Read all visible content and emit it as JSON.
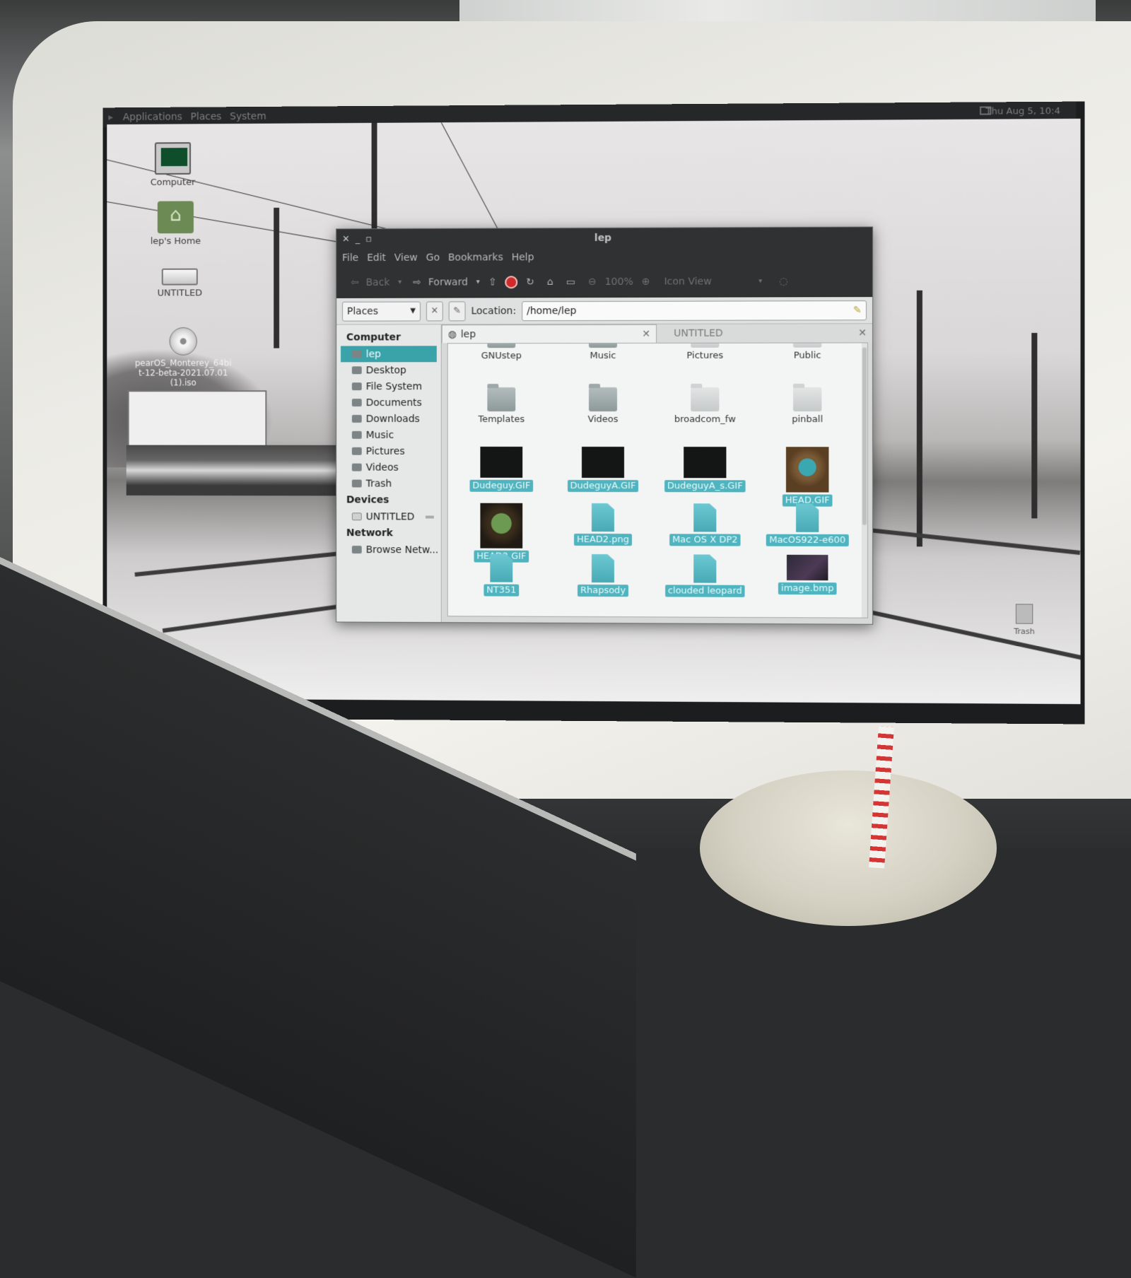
{
  "panel": {
    "menus": [
      "Applications",
      "Places",
      "System"
    ],
    "clock": "Thu Aug 5, 10:4"
  },
  "desktop_icons": [
    {
      "label": "Computer",
      "icon": "computer-icon"
    },
    {
      "label": "lep's Home",
      "icon": "home-folder-icon"
    },
    {
      "label": "UNTITLED",
      "icon": "drive-icon"
    },
    {
      "label": "pearOS_Monterey_64bit-12-beta-2021.07.01(1).iso",
      "icon": "disc-image-icon"
    },
    {
      "label": "Trash",
      "icon": "trash-icon"
    }
  ],
  "window": {
    "title": "lep",
    "menu": [
      "File",
      "Edit",
      "View",
      "Go",
      "Bookmarks",
      "Help"
    ],
    "toolbar": {
      "back": "Back",
      "forward": "Forward",
      "zoom": "100%",
      "view_mode": "Icon View"
    },
    "sidebar_select": "Places",
    "location_label": "Location:",
    "location_value": "/home/lep",
    "sidebar": {
      "computer_heading": "Computer",
      "computer_items": [
        "lep",
        "Desktop",
        "File System",
        "Documents",
        "Downloads",
        "Music",
        "Pictures",
        "Videos",
        "Trash"
      ],
      "devices_heading": "Devices",
      "devices_items": [
        "UNTITLED"
      ],
      "network_heading": "Network",
      "network_items": [
        "Browse Netw..."
      ]
    },
    "tabs": [
      {
        "label": "lep",
        "active": true
      },
      {
        "label": "UNTITLED",
        "active": false
      }
    ],
    "files": [
      {
        "name": "GNUstep",
        "kind": "folder"
      },
      {
        "name": "Music",
        "kind": "folder"
      },
      {
        "name": "Pictures",
        "kind": "folder"
      },
      {
        "name": "Public",
        "kind": "folder"
      },
      {
        "name": "Templates",
        "kind": "folder"
      },
      {
        "name": "Videos",
        "kind": "folder"
      },
      {
        "name": "broadcom_fw",
        "kind": "folder"
      },
      {
        "name": "pinball",
        "kind": "folder"
      },
      {
        "name": "Dudeguy.GIF",
        "kind": "image-dark"
      },
      {
        "name": "DudeguyA.GIF",
        "kind": "image-dark"
      },
      {
        "name": "DudeguyA_s.GIF",
        "kind": "image-dark"
      },
      {
        "name": "HEAD.GIF",
        "kind": "image-face2"
      },
      {
        "name": "HEAD2.GIF",
        "kind": "image-face"
      },
      {
        "name": "HEAD2.png",
        "kind": "document"
      },
      {
        "name": "Mac OS X DP2",
        "kind": "document"
      },
      {
        "name": "MacOS922-e600",
        "kind": "document"
      },
      {
        "name": "NT351",
        "kind": "document"
      },
      {
        "name": "Rhapsody",
        "kind": "document"
      },
      {
        "name": "clouded leopard",
        "kind": "document"
      },
      {
        "name": "image.bmp",
        "kind": "image-bmp"
      }
    ]
  }
}
